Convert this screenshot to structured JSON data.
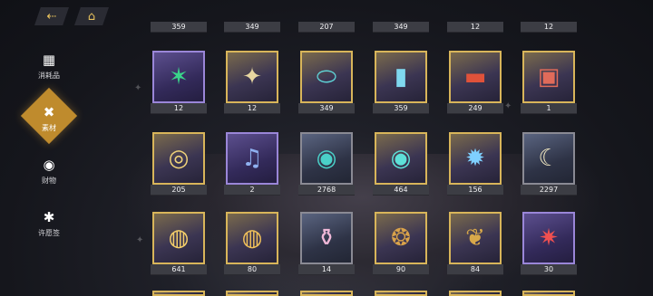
{
  "nav": {
    "back_icon": "back-arrow-icon",
    "home_icon": "home-icon"
  },
  "sidebar": {
    "items": [
      {
        "label": "消耗品",
        "icon": "consumables-icon",
        "glyph": "▦"
      },
      {
        "label": "素材",
        "icon": "materials-icon",
        "glyph": "✖"
      },
      {
        "label": "财物",
        "icon": "valuables-icon",
        "glyph": "◉"
      },
      {
        "label": "许愿签",
        "icon": "wish-tag-icon",
        "glyph": "✱"
      }
    ],
    "active_index": 1
  },
  "top_partial_counts": [
    "359",
    "349",
    "207",
    "349",
    "12",
    "12"
  ],
  "rows": [
    [
      {
        "count": "12",
        "icon": "green-crystal-icon",
        "glyph": "✶",
        "color": "#3ad48a"
      },
      {
        "count": "12",
        "icon": "gold-crystal-icon",
        "glyph": "✦",
        "color": "#e7d6a0"
      },
      {
        "count": "349",
        "icon": "capsule-device-icon",
        "glyph": "⬭",
        "color": "#5fd3d6"
      },
      {
        "count": "359",
        "icon": "tube-vial-icon",
        "glyph": "▮",
        "color": "#7fd8ef"
      },
      {
        "count": "249",
        "icon": "cassette-icon",
        "glyph": "▬",
        "color": "#e0523a"
      },
      {
        "count": "1",
        "icon": "battery-pack-icon",
        "glyph": "▣",
        "color": "#e06b5a"
      }
    ],
    [
      {
        "count": "205",
        "icon": "gold-sphere-icon",
        "glyph": "◎",
        "color": "#f0d37a"
      },
      {
        "count": "2",
        "icon": "gramophone-icon",
        "glyph": "♫",
        "color": "#8fb1f0"
      },
      {
        "count": "2768",
        "icon": "vinyl-record-icon",
        "glyph": "◉",
        "color": "#4ad0c8"
      },
      {
        "count": "464",
        "icon": "vinyl-record-icon",
        "glyph": "◉",
        "color": "#5ee0d8"
      },
      {
        "count": "156",
        "icon": "star-record-icon",
        "glyph": "✹",
        "color": "#7fd0ff"
      },
      {
        "count": "2297",
        "icon": "moon-globe-icon",
        "glyph": "☾",
        "color": "#f0e6c0"
      }
    ],
    [
      {
        "count": "641",
        "icon": "snow-globe-icon",
        "glyph": "◍",
        "color": "#f5cf6a"
      },
      {
        "count": "80",
        "icon": "snow-globe-icon",
        "glyph": "◍",
        "color": "#f0c05a"
      },
      {
        "count": "14",
        "icon": "pink-jar-icon",
        "glyph": "⚱",
        "color": "#f0b8d8"
      },
      {
        "count": "90",
        "icon": "gold-coin-icon",
        "glyph": "❂",
        "color": "#d9a24a"
      },
      {
        "count": "84",
        "icon": "gold-fish-icon",
        "glyph": "❦",
        "color": "#d8a84a"
      },
      {
        "count": "30",
        "icon": "red-star-icon",
        "glyph": "✷",
        "color": "#f05050"
      }
    ]
  ]
}
